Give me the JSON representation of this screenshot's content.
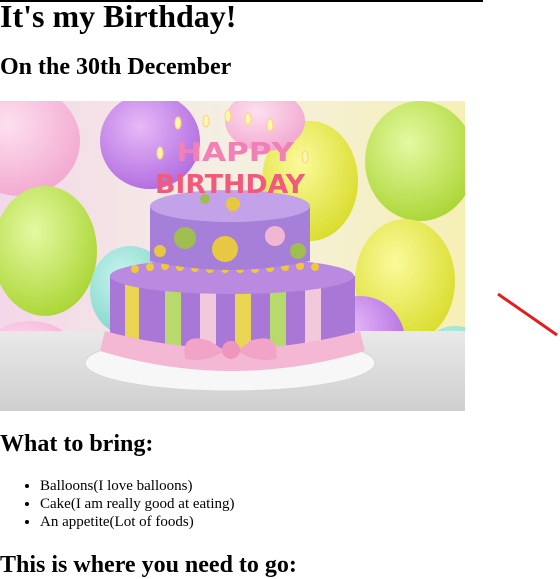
{
  "page": {
    "title": "It's my Birthday!",
    "date_heading": "On the 30th December",
    "image": {
      "name": "birthday-cake-photo",
      "cake_topper": [
        "HAPPY",
        "BIRTHDAY"
      ]
    },
    "bring_heading": "What to bring:",
    "bring_items": [
      "Balloons(I love balloons)",
      "Cake(I am really good at eating)",
      "An appetite(Lot of foods)"
    ],
    "directions_heading": "This is where you need to go:"
  },
  "colors": {
    "text": "#000000",
    "annotation_arrow": "#e02020"
  },
  "icons": {
    "annotation": "diagonal-red-line"
  }
}
